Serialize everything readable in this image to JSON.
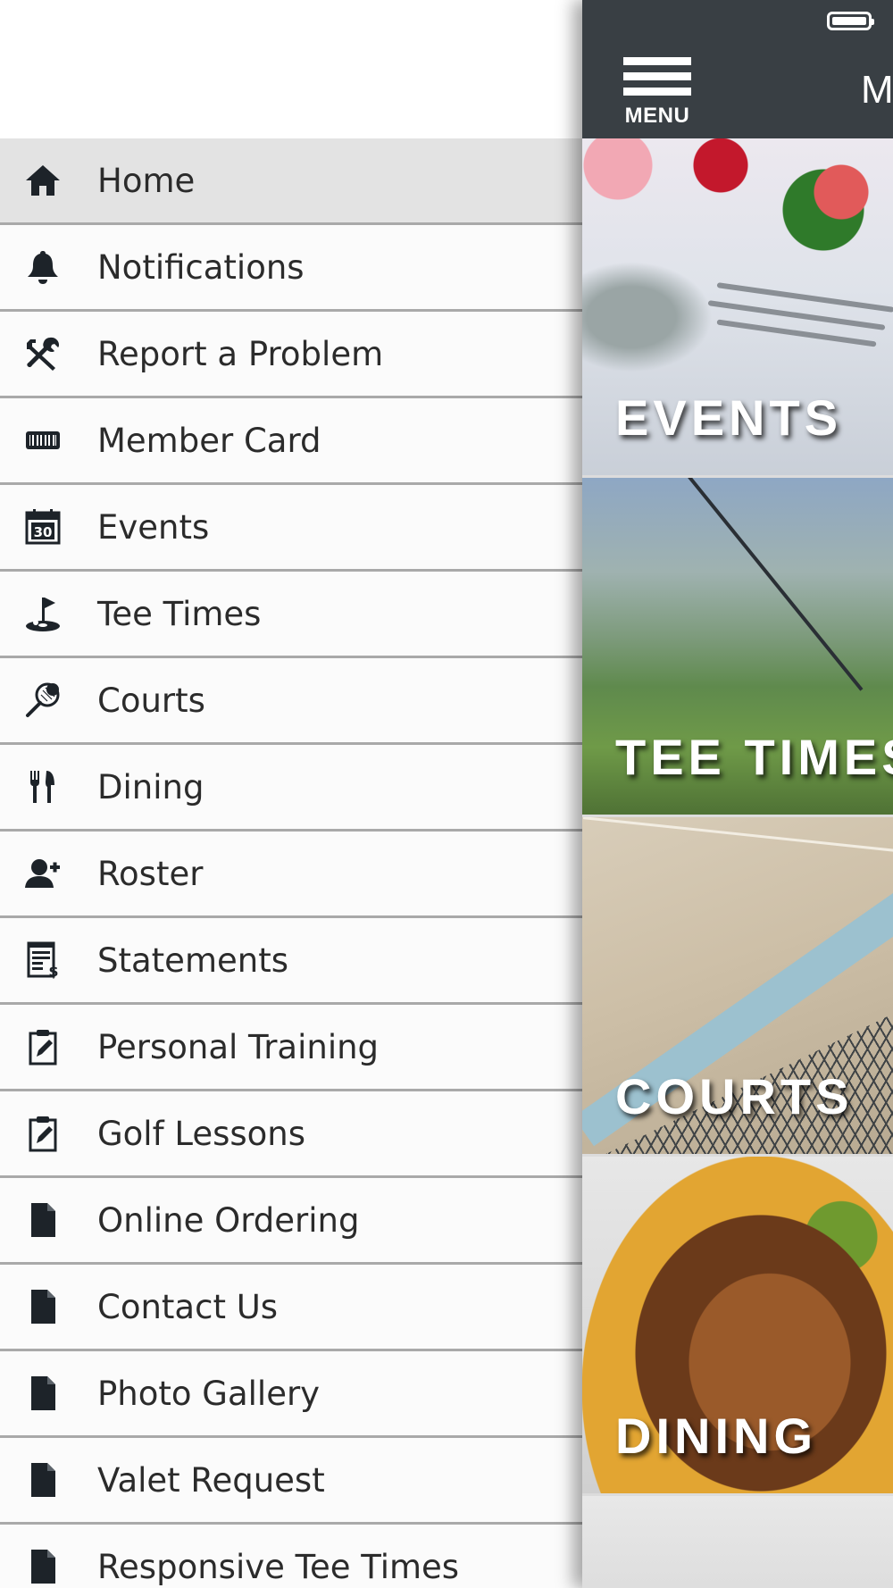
{
  "menu": {
    "items": [
      {
        "label": "Home",
        "icon": "home-icon",
        "active": true
      },
      {
        "label": "Notifications",
        "icon": "bell-icon"
      },
      {
        "label": "Report a Problem",
        "icon": "tools-icon"
      },
      {
        "label": "Member Card",
        "icon": "barcode-card-icon"
      },
      {
        "label": "Events",
        "icon": "calendar-icon",
        "icon_text": "30"
      },
      {
        "label": "Tee Times",
        "icon": "golf-flag-icon"
      },
      {
        "label": "Courts",
        "icon": "tennis-racket-icon"
      },
      {
        "label": "Dining",
        "icon": "fork-knife-icon"
      },
      {
        "label": "Roster",
        "icon": "person-icon"
      },
      {
        "label": "Statements",
        "icon": "statement-icon"
      },
      {
        "label": "Personal Training",
        "icon": "clipboard-edit-icon"
      },
      {
        "label": "Golf Lessons",
        "icon": "clipboard-edit-icon"
      },
      {
        "label": "Online Ordering",
        "icon": "document-icon"
      },
      {
        "label": "Contact Us",
        "icon": "document-icon"
      },
      {
        "label": "Photo Gallery",
        "icon": "document-icon"
      },
      {
        "label": "Valet Request",
        "icon": "document-icon"
      },
      {
        "label": "Responsive Tee Times",
        "icon": "document-icon"
      }
    ]
  },
  "topbar": {
    "menu_label": "MENU",
    "title": "M",
    "battery_icon": "battery-full-icon"
  },
  "tiles": [
    {
      "caption": "EVENTS"
    },
    {
      "caption": "TEE TIMES"
    },
    {
      "caption": "COURTS"
    },
    {
      "caption": "DINING"
    }
  ],
  "colors": {
    "topbar": "#393f44",
    "active_item": "#e3e3e3",
    "divider": "#a9a9a9",
    "icon": "#1d2329"
  }
}
